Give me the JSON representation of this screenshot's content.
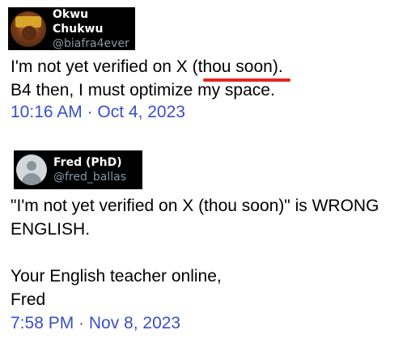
{
  "tweet1": {
    "display_name": "Okwu Chukwu",
    "handle": "@biafra4ever",
    "avatar_icon": "profile-photo-avatar",
    "line1": "I'm not yet verified on X (thou soon).",
    "line2": "B4 then, I must optimize my space.",
    "timestamp": "10:16 AM · Oct 4, 2023",
    "highlighted_text": "(thou soon)",
    "highlight_color": "#e3261f"
  },
  "tweet2": {
    "display_name": "Fred (PhD)",
    "handle": "@fred_ballas",
    "avatar_icon": "default-avatar-icon",
    "line1": "\"I'm not yet verified on X (thou soon)\" is WRONG",
    "line2": "ENGLISH.",
    "line3": "Your English teacher online,",
    "line4": "Fred",
    "timestamp": "7:58 PM · Nov 8, 2023"
  },
  "colors": {
    "header_bg": "#000000",
    "name": "#ffffff",
    "handle": "#8b98a5",
    "timestamp": "#3a4fc7"
  }
}
